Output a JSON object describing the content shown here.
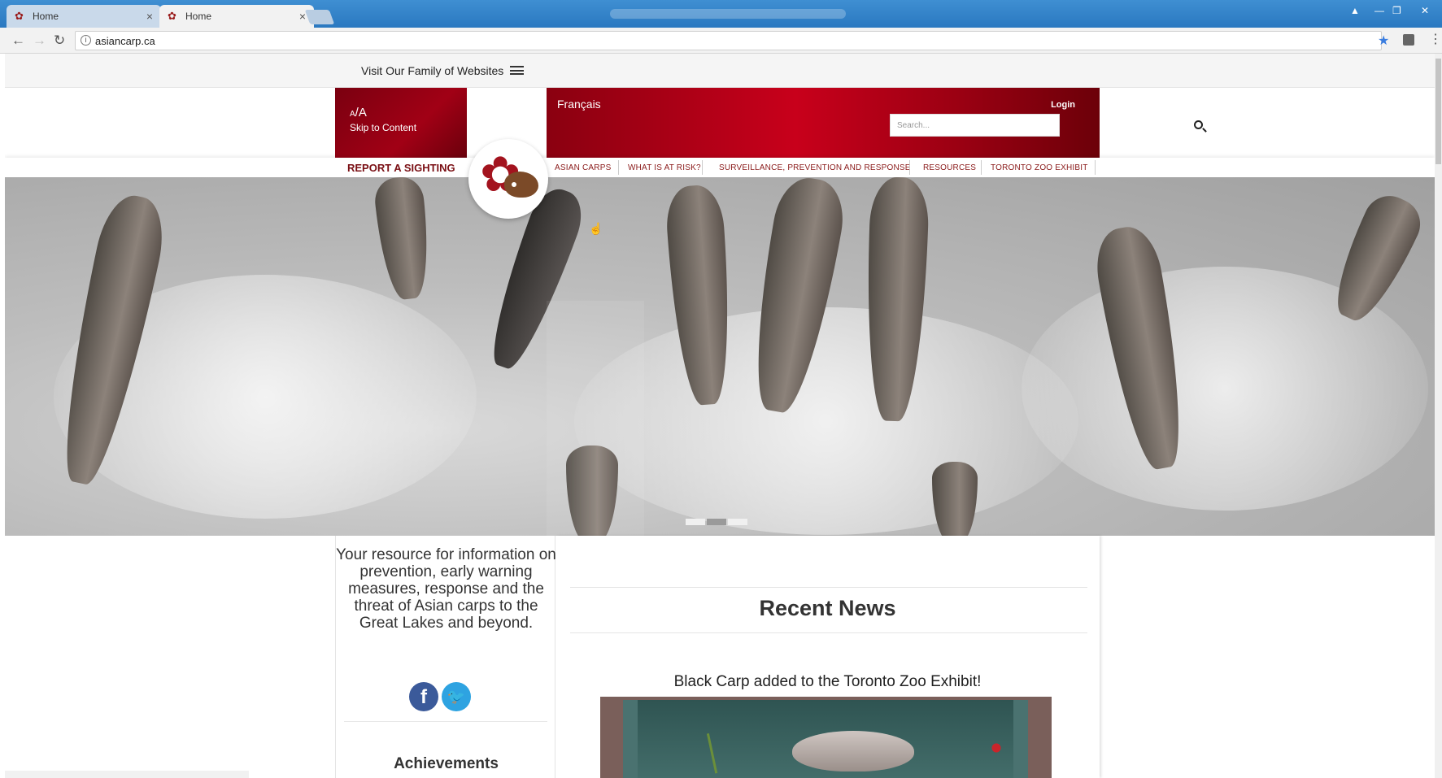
{
  "browser": {
    "tabs": [
      {
        "label": "Home",
        "active": false
      },
      {
        "label": "Home",
        "active": true
      }
    ],
    "url": "asiancarp.ca"
  },
  "site": {
    "family_link": "Visit Our Family of Websites",
    "text_size": {
      "small": "A",
      "large": "A"
    },
    "skip_link": "Skip to Content",
    "language_link": "Français",
    "login_link": "Login",
    "search_placeholder": "Search...",
    "report_link": "REPORT A SIGHTING",
    "nav": [
      "ASIAN CARPS",
      "WHAT IS AT RISK?",
      "SURVEILLANCE, PREVENTION AND RESPONSE",
      "RESOURCES",
      "TORONTO ZOO EXHIBIT"
    ],
    "slider": {
      "slide_count": 3,
      "current_slide": 2
    }
  },
  "content": {
    "tagline": "Your resource for information on prevention, early warning measures, response and the threat of Asian carps to the Great Lakes and beyond.",
    "achievements_heading": "Achievements",
    "news_heading": "Recent News",
    "news_item_title": "Black Carp added to the Toronto Zoo Exhibit!"
  },
  "colors": {
    "brand_red": "#a10015",
    "nav_text": "#8a1a1a"
  }
}
